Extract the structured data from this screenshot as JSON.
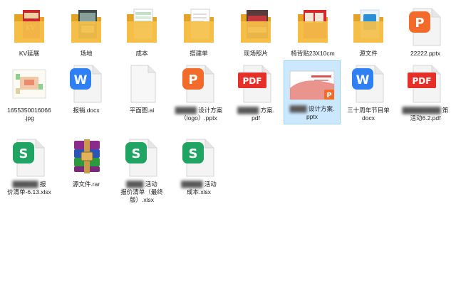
{
  "colors": {
    "folder": "#f5c04a",
    "folder_dark": "#e3a325",
    "wps_presentation": "#f26b2a",
    "pdf": "#e5302a",
    "wps_writer": "#2f7ff5",
    "wps_spreadsheet": "#1fa463",
    "selection": "#cce8ff"
  },
  "files": [
    {
      "label": "KV延展",
      "type": "folder",
      "preview": "red-poster"
    },
    {
      "label": "场地",
      "type": "folder",
      "preview": "venue-photo"
    },
    {
      "label": "成本",
      "type": "folder",
      "preview": "spreadsheet"
    },
    {
      "label": "搭建单",
      "type": "folder",
      "preview": "document"
    },
    {
      "label": "现场照片",
      "type": "folder",
      "preview": "photo"
    },
    {
      "label": "椅背贴23X10cm",
      "type": "folder",
      "preview": "red-banner"
    },
    {
      "label": "源文件",
      "type": "folder",
      "preview": "blue-file"
    },
    {
      "label": "22222.pptx",
      "type": "wps-presentation",
      "icon_letter": "P"
    },
    {
      "label": "1655350016066\n.jpg",
      "type": "image-thumbnail"
    },
    {
      "label": "报销.docx",
      "type": "wps-writer",
      "icon_letter": "W"
    },
    {
      "label": "平面图.ai",
      "type": "blank-document"
    },
    {
      "label": "设计方案\n（logo）.pptx",
      "label_obscured": "█████",
      "type": "wps-presentation",
      "icon_letter": "P"
    },
    {
      "label": "方案.\npdf",
      "label_obscured": "█████",
      "type": "pdf",
      "icon_text": "PDF"
    },
    {
      "label": "设计方案.\npptx",
      "label_obscured": "████",
      "type": "presentation-thumbnail",
      "selected": true
    },
    {
      "label": "三十周年节目单\ndocx",
      "type": "wps-writer",
      "icon_letter": "W"
    },
    {
      "label": "策\n活动6.2.pdf",
      "label_obscured": "█████████",
      "type": "pdf",
      "icon_text": "PDF"
    },
    {
      "label": "报\n价清单-6.13.xlsx",
      "label_obscured": "██████",
      "type": "wps-spreadsheet",
      "icon_letter": "S"
    },
    {
      "label": "源文件.rar",
      "type": "winrar-archive"
    },
    {
      "label": "活动\n报价清单（最终\n版）.xlsx",
      "label_obscured": "████",
      "type": "wps-spreadsheet",
      "icon_letter": "S"
    },
    {
      "label": "活动\n成本.xlsx",
      "label_obscured": "█████",
      "type": "wps-spreadsheet",
      "icon_letter": "S"
    }
  ]
}
